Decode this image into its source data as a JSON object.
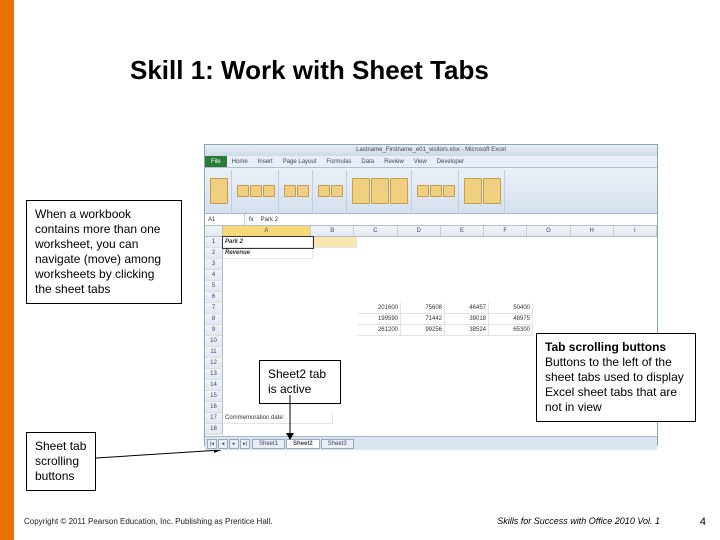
{
  "title": "Skill 1: Work with Sheet Tabs",
  "callouts": {
    "workbook": "When a workbook contains more than one worksheet, you can navigate (move) among worksheets by clicking the sheet tabs",
    "sheet2": "Sheet2 tab is active",
    "scrollbtns": "Sheet tab scrolling buttons",
    "scrolling_title": "Tab scrolling buttons",
    "scrolling_body": "Buttons to the left of the sheet tabs used to display Excel sheet tabs that are not in view"
  },
  "excel": {
    "titlebar": "Lastname_Firstname_e01_visitors.xlsx - Microsoft Excel",
    "ribbontabs": [
      "Home",
      "Insert",
      "Page Layout",
      "Formulas",
      "Data",
      "Review",
      "View",
      "Developer"
    ],
    "namebox": "A1",
    "fxcontent": "Park 2",
    "columns": [
      "A",
      "B",
      "C",
      "D",
      "E",
      "F",
      "G",
      "H",
      "I"
    ],
    "a1": "Park 2",
    "a2": "Revenue",
    "a17": "Commemoration date:",
    "data": {
      "r7": [
        "201600",
        "75608",
        "46457",
        "50400"
      ],
      "r8": [
        "199590",
        "71442",
        "39018",
        "48975"
      ],
      "r9": [
        "261200",
        "99256",
        "38524",
        "65300"
      ]
    },
    "sheets": [
      "Sheet1",
      "Sheet2",
      "Sheet3"
    ]
  },
  "footer": {
    "left": "Copyright © 2011 Pearson Education, Inc. Publishing as Prentice Hall.",
    "right": "Skills for Success with Office 2010 Vol. 1",
    "page": "4"
  }
}
